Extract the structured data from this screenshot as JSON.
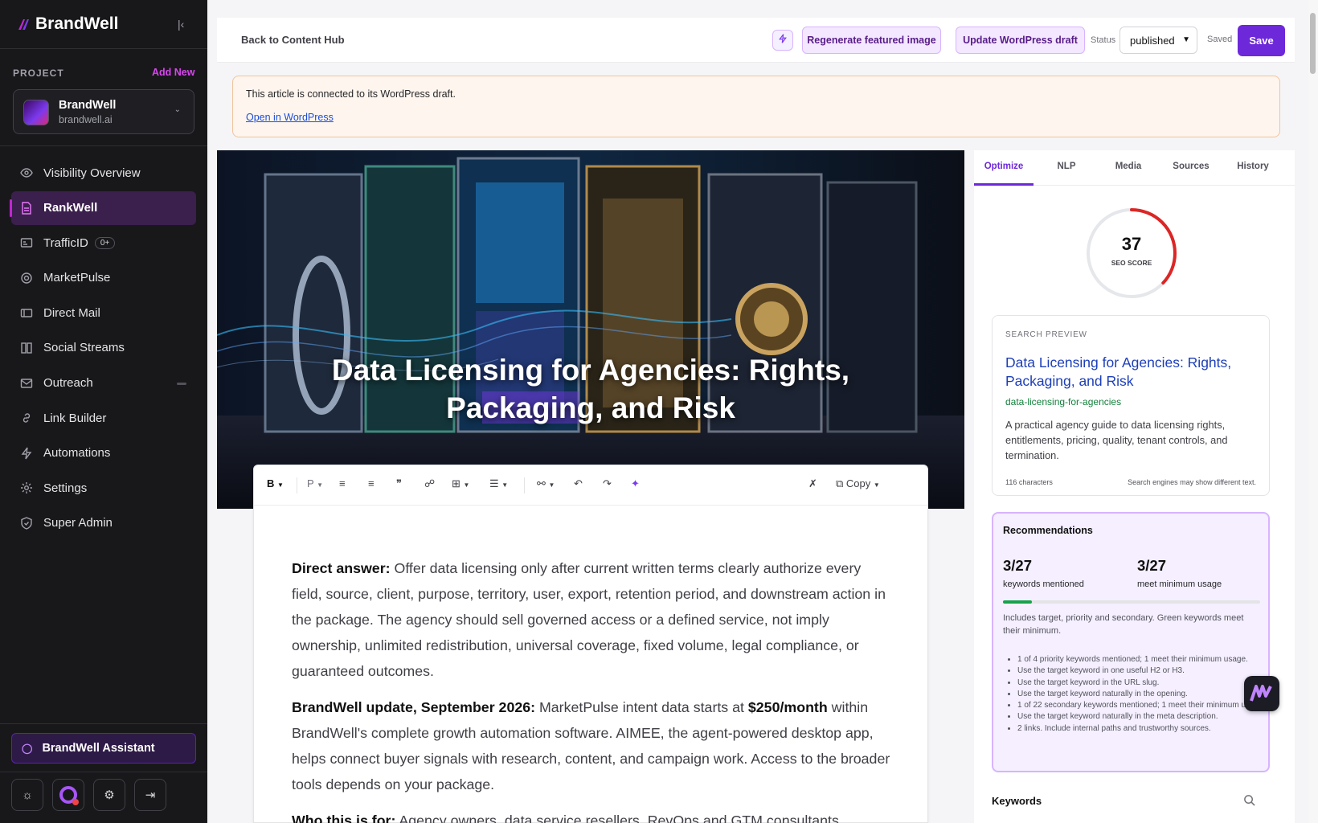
{
  "brand": {
    "name": "BrandWell"
  },
  "sidebar": {
    "project_label": "PROJECT",
    "add_new": "Add New",
    "project": {
      "name": "BrandWell",
      "domain": "brandwell.ai"
    },
    "items": [
      {
        "label": "Visibility Overview",
        "icon": "eye-icon"
      },
      {
        "label": "RankWell",
        "icon": "document-icon",
        "active": true
      },
      {
        "label": "TrafficID",
        "icon": "id-card-icon",
        "badge": "0+"
      },
      {
        "label": "MarketPulse",
        "icon": "target-icon"
      },
      {
        "label": "Direct Mail",
        "icon": "mailbox-icon"
      },
      {
        "label": "Social Streams",
        "icon": "columns-icon"
      },
      {
        "label": "Outreach",
        "icon": "envelope-icon"
      },
      {
        "label": "Link Builder",
        "icon": "link-icon"
      },
      {
        "label": "Automations",
        "icon": "bolt-icon"
      },
      {
        "label": "Settings",
        "icon": "gear-icon"
      },
      {
        "label": "Super Admin",
        "icon": "shield-icon"
      }
    ],
    "assistant": "BrandWell Assistant"
  },
  "topbar": {
    "back": "Back to Content Hub",
    "regenerate": "Regenerate featured image",
    "update_wp": "Update WordPress draft",
    "status_label": "Status",
    "status_value": "published",
    "saved": "Saved",
    "save": "Save"
  },
  "banner": {
    "text": "This article is connected to its WordPress draft.",
    "link": "Open in WordPress"
  },
  "hero": {
    "title": "Data Licensing for Agencies: Rights, Packaging, and Risk"
  },
  "editor": {
    "toolbar": {
      "bold": "B",
      "paragraph": "P",
      "copy": "Copy"
    },
    "p1_lead": "Direct answer:",
    "p1_text": " Offer data licensing only after current written terms clearly authorize every field, source, client, purpose, territory, user, export, retention period, and downstream action in the package. The agency should sell governed access or a defined service, not imply ownership, unlimited redistribution, universal coverage, fixed volume, legal compliance, or guaranteed outcomes.",
    "p2_lead": "BrandWell update, September 2026:",
    "p2_text1": " MarketPulse intent data starts at ",
    "p2_price": "$250/month",
    "p2_text2": " within BrandWell's complete growth automation software. AIMEE, the agent-powered desktop app, helps connect buyer signals with research, content, and campaign work. Access to the broader tools depends on your package.",
    "p3_lead": "Who this is for:",
    "p3_text": " Agency owners, data service resellers, RevOps and GTM consultants"
  },
  "panel": {
    "tabs": [
      "Optimize",
      "NLP",
      "Media",
      "Sources",
      "History"
    ],
    "active_tab": "Optimize",
    "score": {
      "value": "37",
      "label": "SEO SCORE",
      "fraction": 0.37,
      "color": "#dc2626"
    },
    "search_preview": {
      "heading": "SEARCH PREVIEW",
      "title": "Data Licensing for Agencies: Rights, Packaging, and Risk",
      "slug": "data-licensing-for-agencies",
      "description": "A practical agency guide to data licensing rights, entitlements, pricing, quality, tenant controls, and termination.",
      "chars": "116 characters",
      "note": "Search engines may show different text."
    },
    "recommendations": {
      "heading": "Recommendations",
      "v1": "3/27",
      "l1": "keywords mentioned",
      "v2": "3/27",
      "l2": "meet minimum usage",
      "progress": 0.111,
      "note": "Includes target, priority and secondary. Green keywords meet their minimum.",
      "items": [
        "1 of 4 priority keywords mentioned; 1 meet their minimum usage.",
        "Use the target keyword in one useful H2 or H3.",
        "Use the target keyword in the URL slug.",
        "Use the target keyword naturally in the opening.",
        "1 of 22 secondary keywords mentioned; 1 meet their minimum usage.",
        "Use the target keyword naturally in the meta description.",
        "2 links. Include internal paths and trustworthy sources."
      ]
    },
    "keywords_heading": "Keywords"
  },
  "colors": {
    "accent": "#6d28d9",
    "sidebar": "#18181b",
    "brand_pink": "#d946ef"
  }
}
